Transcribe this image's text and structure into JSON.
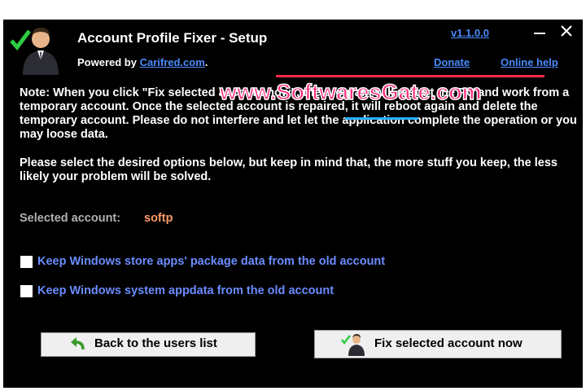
{
  "window": {
    "title": "Account Profile Fixer - Setup",
    "powered_by_prefix": "Powered by ",
    "powered_by_link": "Carifred.com",
    "powered_by_suffix": ".",
    "version": "v1.1.0.0",
    "donate": "Donate",
    "online_help": "Online help",
    "minimize_icon": "minimize-icon",
    "close_icon": "close-icon"
  },
  "content": {
    "note": "Note: When you click \"Fix selected account now\", the program will restart the PC and work from a temporary account. Once the selected account is repaired, it will reboot again and delete the temporary account. Please do not interfere and let let the application complete the operation or you may loose data.",
    "options_note": "Please select the desired options below, but keep in mind that, the more stuff you keep, the less likely your problem will be solved.",
    "selected_account_label": "Selected account:",
    "selected_account_value": "softp"
  },
  "options": [
    {
      "label": "Keep Windows store apps' package data from the old account",
      "checked": false
    },
    {
      "label": "Keep Windows system appdata from the old account",
      "checked": false
    }
  ],
  "buttons": {
    "back": "Back to the users list",
    "back_icon": "back-arrow-icon",
    "fix": "Fix selected account now",
    "fix_icon": "user-check-icon"
  },
  "watermark": "www.SoftwaresGate.com",
  "colors": {
    "background": "#000000",
    "link": "#4a8cff",
    "checkbox_label": "#6b8cff",
    "account_value": "#ff9a6a",
    "check_green": "#2ecc40"
  }
}
